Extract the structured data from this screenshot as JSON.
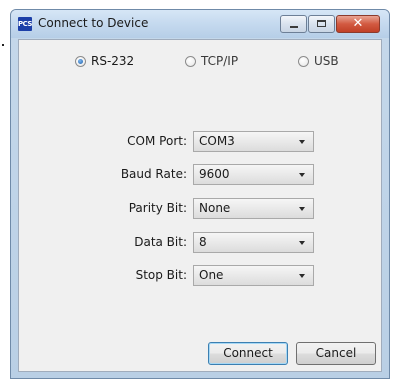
{
  "window": {
    "title": "Connect to Device",
    "app_icon_text": "PCS"
  },
  "connection_types": [
    {
      "label": "RS-232",
      "selected": true
    },
    {
      "label": "TCP/IP",
      "selected": false
    },
    {
      "label": "USB",
      "selected": false
    }
  ],
  "fields": {
    "com_port": {
      "label": "COM Port:",
      "value": "COM3"
    },
    "baud_rate": {
      "label": "Baud Rate:",
      "value": "9600"
    },
    "parity_bit": {
      "label": "Parity Bit:",
      "value": "None"
    },
    "data_bit": {
      "label": "Data Bit:",
      "value": "8"
    },
    "stop_bit": {
      "label": "Stop Bit:",
      "value": "One"
    }
  },
  "buttons": {
    "connect": "Connect",
    "cancel": "Cancel"
  },
  "icons": {
    "minimize": "minimize-icon",
    "maximize": "maximize-icon",
    "close": "close-icon",
    "dropdown": "chevron-down-icon"
  },
  "colors": {
    "titlebar": "#c3d8ee",
    "client_bg": "#f0f0f0",
    "close_button": "#d25a41",
    "default_button_border": "#3c7fb1",
    "radio_selected": "#1c5ea8"
  }
}
